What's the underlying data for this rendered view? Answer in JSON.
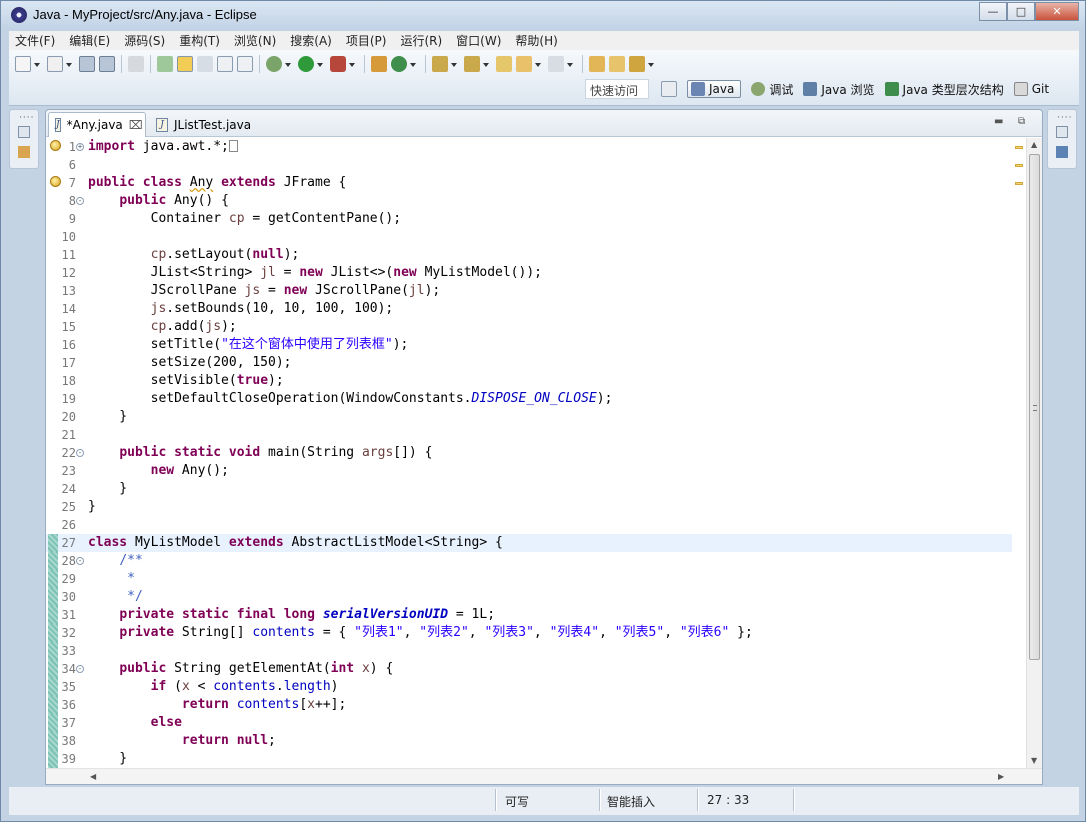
{
  "window": {
    "title": "Java  -  MyProject/src/Any.java  -  Eclipse",
    "controls": [
      "minimize",
      "maximize",
      "close"
    ]
  },
  "menubar": [
    "文件(F)",
    "编辑(E)",
    "源码(S)",
    "重构(T)",
    "浏览(N)",
    "搜索(A)",
    "项目(P)",
    "运行(R)",
    "窗口(W)",
    "帮助(H)"
  ],
  "toolbar": {
    "quick_access": "快速访问",
    "perspectives": [
      {
        "label": "Java",
        "icon": "java-perspective-icon",
        "active": true
      },
      {
        "label": "调试",
        "icon": "debug-perspective-icon",
        "active": false
      },
      {
        "label": "Java 浏览",
        "icon": "java-browsing-icon",
        "active": false
      },
      {
        "label": "Java 类型层次结构",
        "icon": "type-hierarchy-icon",
        "active": false
      },
      {
        "label": "Git",
        "icon": "git-icon",
        "active": false
      }
    ]
  },
  "editor": {
    "tabs": [
      {
        "label": "*Any.java",
        "active": true
      },
      {
        "label": "JListTest.java",
        "active": false
      }
    ],
    "current_line": 27,
    "lines": [
      {
        "n": "1",
        "text": "import java.awt.*;"
      },
      {
        "n": "6",
        "text": ""
      },
      {
        "n": "7",
        "text": "public class Any extends JFrame {"
      },
      {
        "n": "8",
        "text": "    public Any() {"
      },
      {
        "n": "9",
        "text": "        Container cp = getContentPane();"
      },
      {
        "n": "10",
        "text": ""
      },
      {
        "n": "11",
        "text": "        cp.setLayout(null);"
      },
      {
        "n": "12",
        "text": "        JList<String> jl = new JList<>(new MyListModel());"
      },
      {
        "n": "13",
        "text": "        JScrollPane js = new JScrollPane(jl);"
      },
      {
        "n": "14",
        "text": "        js.setBounds(10, 10, 100, 100);"
      },
      {
        "n": "15",
        "text": "        cp.add(js);"
      },
      {
        "n": "16",
        "text": "        setTitle(\"在这个窗体中使用了列表框\");"
      },
      {
        "n": "17",
        "text": "        setSize(200, 150);"
      },
      {
        "n": "18",
        "text": "        setVisible(true);"
      },
      {
        "n": "19",
        "text": "        setDefaultCloseOperation(WindowConstants.DISPOSE_ON_CLOSE);"
      },
      {
        "n": "20",
        "text": "    }"
      },
      {
        "n": "21",
        "text": ""
      },
      {
        "n": "22",
        "text": "    public static void main(String args[]) {"
      },
      {
        "n": "23",
        "text": "        new Any();"
      },
      {
        "n": "24",
        "text": "    }"
      },
      {
        "n": "25",
        "text": "}"
      },
      {
        "n": "26",
        "text": ""
      },
      {
        "n": "27",
        "text": "class MyListModel extends AbstractListModel<String> {"
      },
      {
        "n": "28",
        "text": "    /**"
      },
      {
        "n": "29",
        "text": "     *"
      },
      {
        "n": "30",
        "text": "     */"
      },
      {
        "n": "31",
        "text": "    private static final long serialVersionUID = 1L;"
      },
      {
        "n": "32",
        "text": "    private String[] contents = { \"列表1\", \"列表2\", \"列表3\", \"列表4\", \"列表5\", \"列表6\" };"
      },
      {
        "n": "33",
        "text": ""
      },
      {
        "n": "34",
        "text": "    public String getElementAt(int x) {"
      },
      {
        "n": "35",
        "text": "        if (x < contents.length)"
      },
      {
        "n": "36",
        "text": "            return contents[x++];"
      },
      {
        "n": "37",
        "text": "        else"
      },
      {
        "n": "38",
        "text": "            return null;"
      },
      {
        "n": "39",
        "text": "    }"
      }
    ]
  },
  "statusbar": {
    "writable": "可写",
    "insert_mode": "智能插入",
    "position": "27 : 33"
  }
}
